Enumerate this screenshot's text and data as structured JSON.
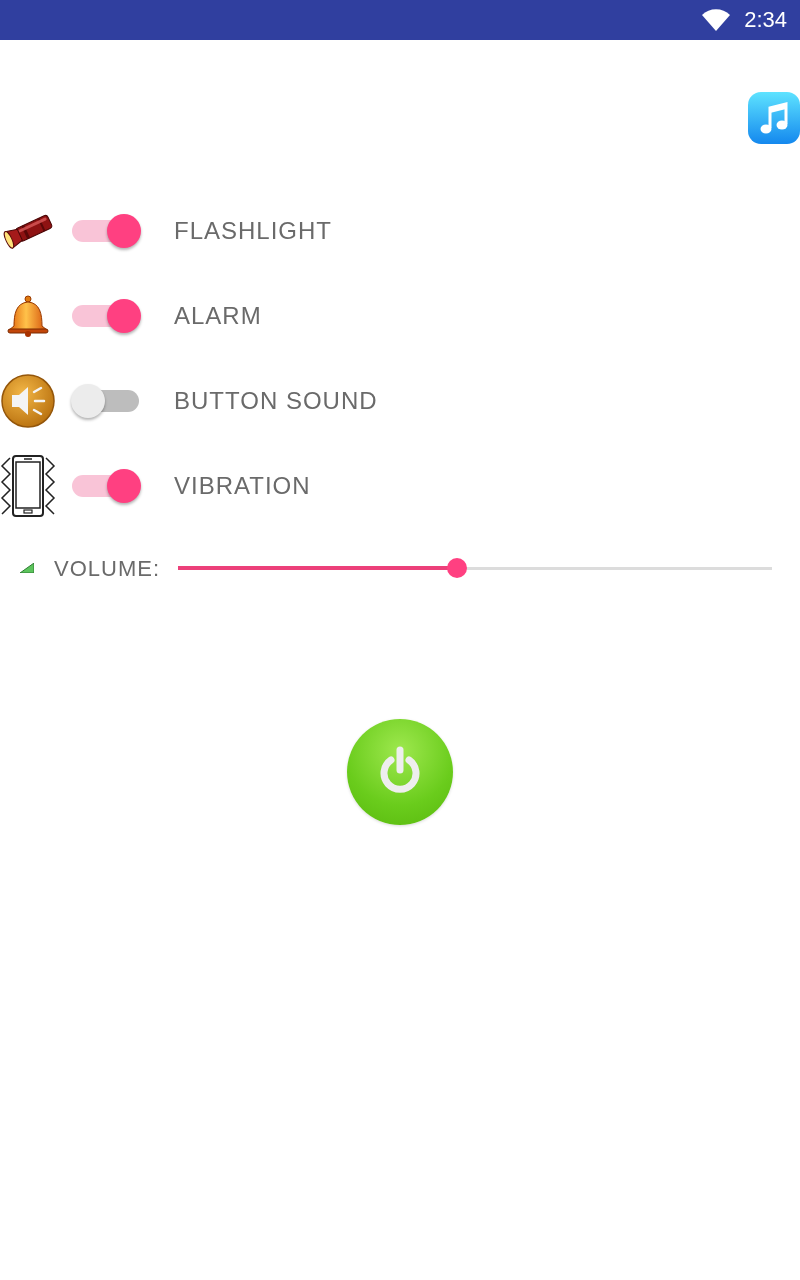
{
  "status_bar": {
    "time": "2:34"
  },
  "settings": [
    {
      "kind": "flashlight",
      "label": "FLASHLIGHT",
      "on": true
    },
    {
      "kind": "alarm",
      "label": "ALARM",
      "on": true
    },
    {
      "kind": "sound",
      "label": "BUTTON SOUND",
      "on": false
    },
    {
      "kind": "vibration",
      "label": "VIBRATION",
      "on": true
    }
  ],
  "volume": {
    "label": "VOLUME:",
    "level": 0.47
  }
}
